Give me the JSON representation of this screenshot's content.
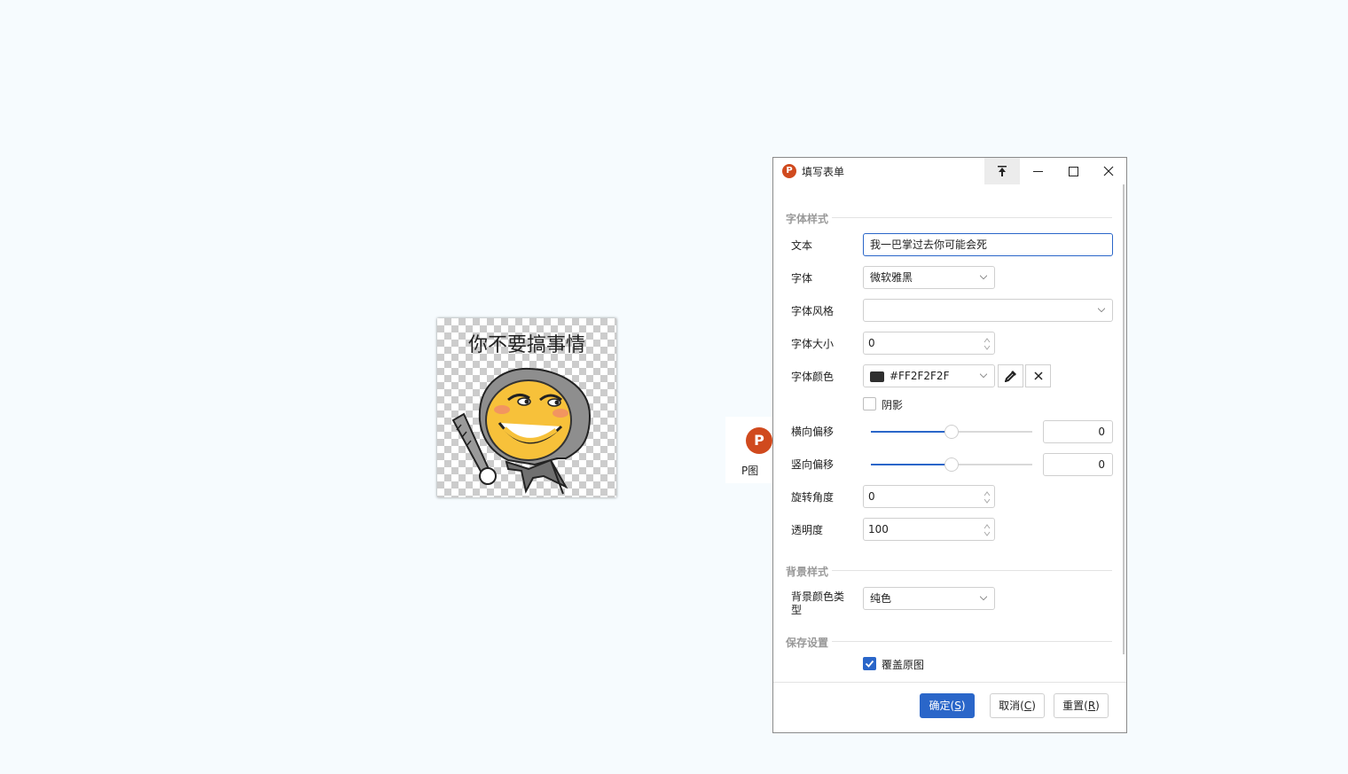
{
  "preview": {
    "caption": "你不要搞事情"
  },
  "desktop_icon": {
    "letter": "P",
    "label": "P图"
  },
  "dialog": {
    "title": "填写表单",
    "app_icon_letter": "P",
    "font_style_section": "字体样式",
    "text_label": "文本",
    "text_value": "我一巴掌过去你可能会死",
    "font_label": "字体",
    "font_value": "微软雅黑",
    "font_style_label": "字体风格",
    "font_style_value": "",
    "font_size_label": "字体大小",
    "font_size_value": "0",
    "font_color_label": "字体颜色",
    "font_color_value": "#FF2F2F2F",
    "font_color_swatch": "#2f2f2f",
    "shadow_label": "阴影",
    "shadow_checked": false,
    "h_offset_label": "横向偏移",
    "h_offset_value": "0",
    "h_offset_level": 0.5,
    "v_offset_label": "竖向偏移",
    "v_offset_value": "0",
    "v_offset_level": 0.5,
    "rotation_label": "旋转角度",
    "rotation_value": "0",
    "opacity_label": "透明度",
    "opacity_value": "100",
    "bg_section": "背景样式",
    "bg_color_type_label_1": "背景颜色类",
    "bg_color_type_label_2": "型",
    "bg_color_type_value": "纯色",
    "save_section": "保存设置",
    "overwrite_label": "覆盖原图",
    "overwrite_checked": true,
    "ok_button": "确定(S)",
    "ok_text": "确定(",
    "ok_key": "S",
    "cancel_text": "取消(",
    "cancel_key": "C",
    "reset_text": "重置(",
    "reset_key": "R",
    "close_paren": ")"
  },
  "colors": {
    "accent": "#2a66c9",
    "app_icon": "#d04a1e",
    "background": "#f6fbfe"
  }
}
